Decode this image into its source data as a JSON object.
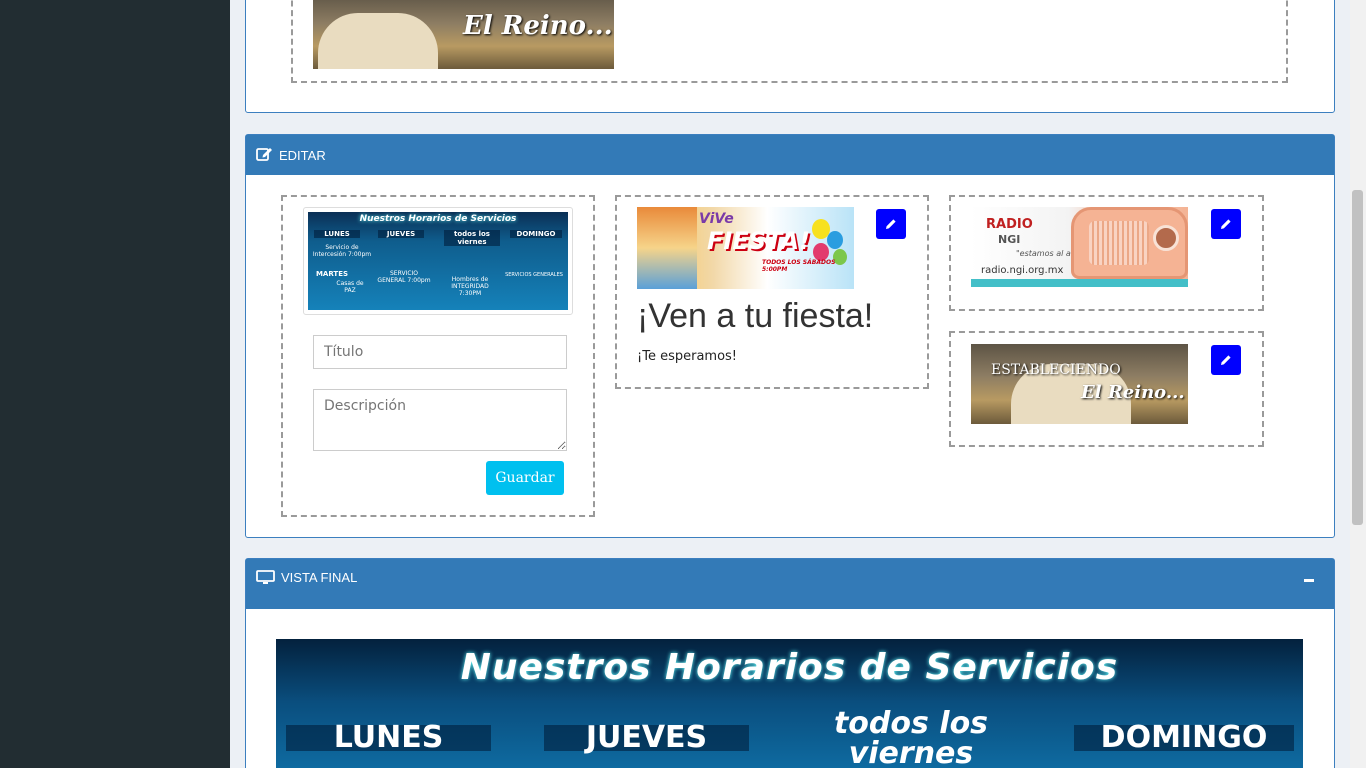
{
  "panels": {
    "editar": {
      "title": "EDITAR"
    },
    "vista_final": {
      "title": "VISTA FINAL"
    }
  },
  "banners": {
    "establishing": {
      "line1": "ESTABLECIENDO",
      "line2": "El Reino..."
    },
    "horarios": {
      "header": "Nuestros Horarios de Servicios",
      "days": [
        "LUNES",
        "JUEVES",
        "todos los viernes",
        "DOMINGO"
      ],
      "lunes_detail": "Servicio de Intercesión 7:00pm",
      "martes": "MARTES",
      "martes_detail": "Casas de PAZ",
      "jueves_detail": "SERVICIO GENERAL 7:00pm",
      "viernes_detail": "Hombres de INTEGRIDAD 7:30PM",
      "domingo_detail": "SERVICIOS GENERALES"
    },
    "fiesta": {
      "vive": "ViVe",
      "word": "FIESTA!",
      "tag": "TODOS LOS SÁBADOS 5:00PM"
    },
    "radio": {
      "title": "RADIO",
      "subtitle": "NGI",
      "slogan": "\"estamos al aire por ti\"",
      "url": "radio.ngi.org.mx"
    }
  },
  "form": {
    "title_placeholder": "Título",
    "description_placeholder": "Descripción",
    "save_label": "Guardar"
  },
  "card_fiesta": {
    "heading": "¡Ven a tu fiesta!",
    "text": "¡Te esperamos!"
  },
  "colors": {
    "panel_header": "#337ab7",
    "edit_button": "#0000ff",
    "save_button": "#00c0ef",
    "sidebar": "#222d32"
  },
  "icons": {
    "editar": "edit-square-icon",
    "vista_final": "monitor-icon",
    "edit_button": "pencil-icon",
    "collapse": "minus-icon"
  }
}
